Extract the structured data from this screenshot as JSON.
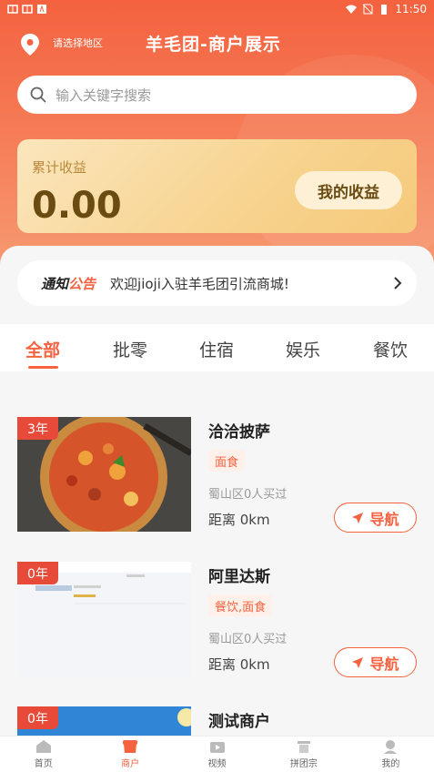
{
  "status_bar": {
    "time": "11:50"
  },
  "header": {
    "region": "请选择地区",
    "title": "羊毛团-商户展示"
  },
  "search": {
    "placeholder": "输入关键字搜索"
  },
  "earnings": {
    "label": "累计收益",
    "value": "0.00",
    "button": "我的收益"
  },
  "notice": {
    "logo_a": "通知",
    "logo_b": "公告",
    "text": "欢迎jioji入驻羊毛团引流商城!"
  },
  "tabs": [
    {
      "label": "全部",
      "active": true
    },
    {
      "label": "批零",
      "active": false
    },
    {
      "label": "住宿",
      "active": false
    },
    {
      "label": "娱乐",
      "active": false
    },
    {
      "label": "餐饮",
      "active": false
    }
  ],
  "merchants": [
    {
      "badge": "3年",
      "name": "洽洽披萨",
      "tag": "面食",
      "sold": "蜀山区0人买过",
      "distance": "距离 0km",
      "nav": "导航",
      "image": "pizza"
    },
    {
      "badge": "0年",
      "name": "阿里达斯",
      "tag": "餐饮,面食",
      "sold": "蜀山区0人买过",
      "distance": "距离 0km",
      "nav": "导航",
      "image": "screenshot"
    },
    {
      "badge": "0年",
      "name": "测试商户",
      "image": "sky"
    }
  ],
  "bottom_nav": [
    {
      "label": "首页",
      "icon": "home-icon",
      "active": false
    },
    {
      "label": "商户",
      "icon": "store-icon",
      "active": true
    },
    {
      "label": "视频",
      "icon": "video-icon",
      "active": false
    },
    {
      "label": "拼团宗",
      "icon": "group-icon",
      "active": false
    },
    {
      "label": "我的",
      "icon": "user-icon",
      "active": false
    }
  ],
  "colors": {
    "accent": "#f4623f",
    "gold": "#f7d38e",
    "badge": "#e84a3a"
  }
}
